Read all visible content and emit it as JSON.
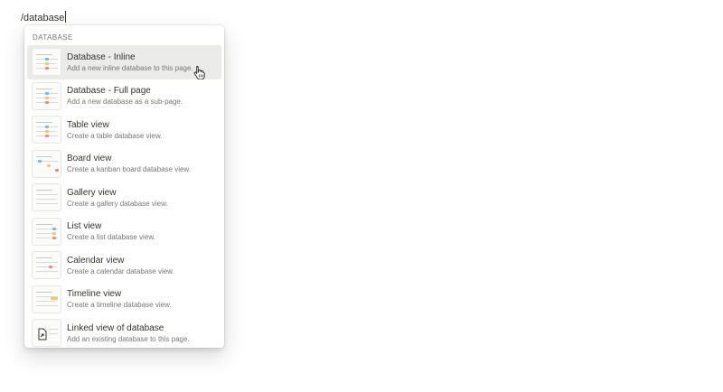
{
  "editor": {
    "text": "/database"
  },
  "menu": {
    "section_label": "DATABASE",
    "items": [
      {
        "title": "Database - Inline",
        "description": "Add a new inline database to this page."
      },
      {
        "title": "Database - Full page",
        "description": "Add a new database as a sub-page."
      },
      {
        "title": "Table view",
        "description": "Create a table database view."
      },
      {
        "title": "Board view",
        "description": "Create a kanban board database view."
      },
      {
        "title": "Gallery view",
        "description": "Create a gallery database view."
      },
      {
        "title": "List view",
        "description": "Create a list database view."
      },
      {
        "title": "Calendar view",
        "description": "Create a calendar database view."
      },
      {
        "title": "Timeline view",
        "description": "Create a timeline database view."
      },
      {
        "title": "Linked view of database",
        "description": "Add an existing database to this page."
      }
    ]
  }
}
